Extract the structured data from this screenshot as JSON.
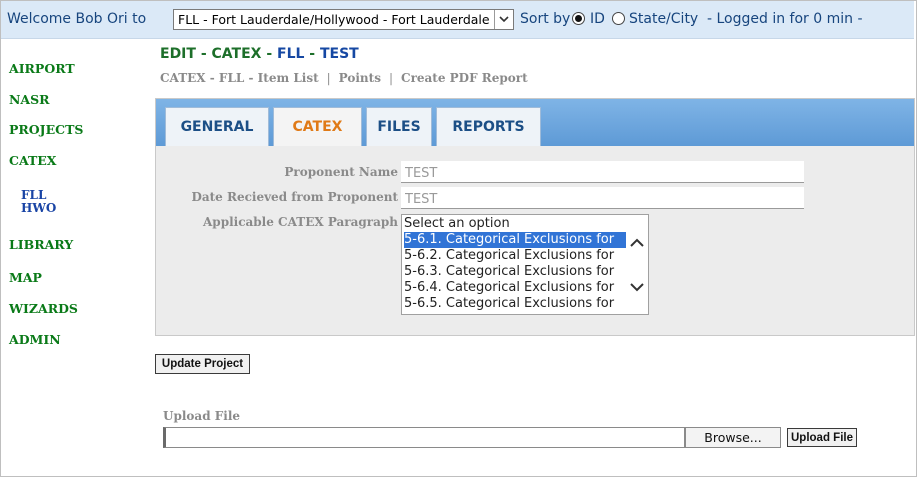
{
  "topbar": {
    "welcome_text": "Welcome Bob Ori to",
    "airport_select_value": "FLL - Fort Lauderdale/Hollywood - Fort Lauderdale",
    "sort_label": "Sort by",
    "sort_options": [
      "ID",
      "State/City"
    ],
    "selected_sort": "ID",
    "logged_in_text": "- Logged in for 0 min -"
  },
  "sidebar": {
    "items": [
      {
        "label": "AIRPORT"
      },
      {
        "label": "NASR"
      },
      {
        "label": "PROJECTS"
      },
      {
        "label": "CATEX"
      },
      {
        "label": "FLL"
      },
      {
        "label": "HWO"
      },
      {
        "label": "LIBRARY"
      },
      {
        "label": "MAP"
      },
      {
        "label": "WIZARDS"
      },
      {
        "label": "ADMIN"
      }
    ]
  },
  "header": {
    "title_parts": [
      "EDIT",
      " - ",
      "CATEX",
      " - ",
      "FLL",
      " - ",
      "TEST"
    ],
    "links": [
      "CATEX - FLL - Item List",
      "Points",
      "Create PDF Report"
    ],
    "link_separator": "|"
  },
  "tabs": [
    "GENERAL",
    "CATEX",
    "FILES",
    "REPORTS"
  ],
  "active_tab": "CATEX",
  "form": {
    "proponent_name_label": "Proponent Name",
    "proponent_name_value": "TEST",
    "date_received_label": "Date Recieved from Proponent",
    "date_received_value": "TEST",
    "catex_paragraph_label": "Applicable CATEX Paragraph",
    "catex_options": [
      "Select an option",
      "5-6.1. Categorical Exclusions for",
      "5-6.2. Categorical Exclusions for",
      "5-6.3. Categorical Exclusions for",
      "5-6.4. Categorical Exclusions for",
      "5-6.5. Categorical Exclusions for"
    ],
    "selected_option": "5-6.1. Categorical Exclusions for"
  },
  "actions": {
    "update_project": "Update Project",
    "upload_file_label": "Upload File",
    "browse": "Browse...",
    "upload_file_button": "Upload File"
  },
  "colors": {
    "topbar_bg": "#dbe9f7",
    "nav_green": "#0a7a18",
    "nav_blue": "#1944a5",
    "active_tab_text": "#e07a17",
    "selection_blue": "#3174d6"
  }
}
